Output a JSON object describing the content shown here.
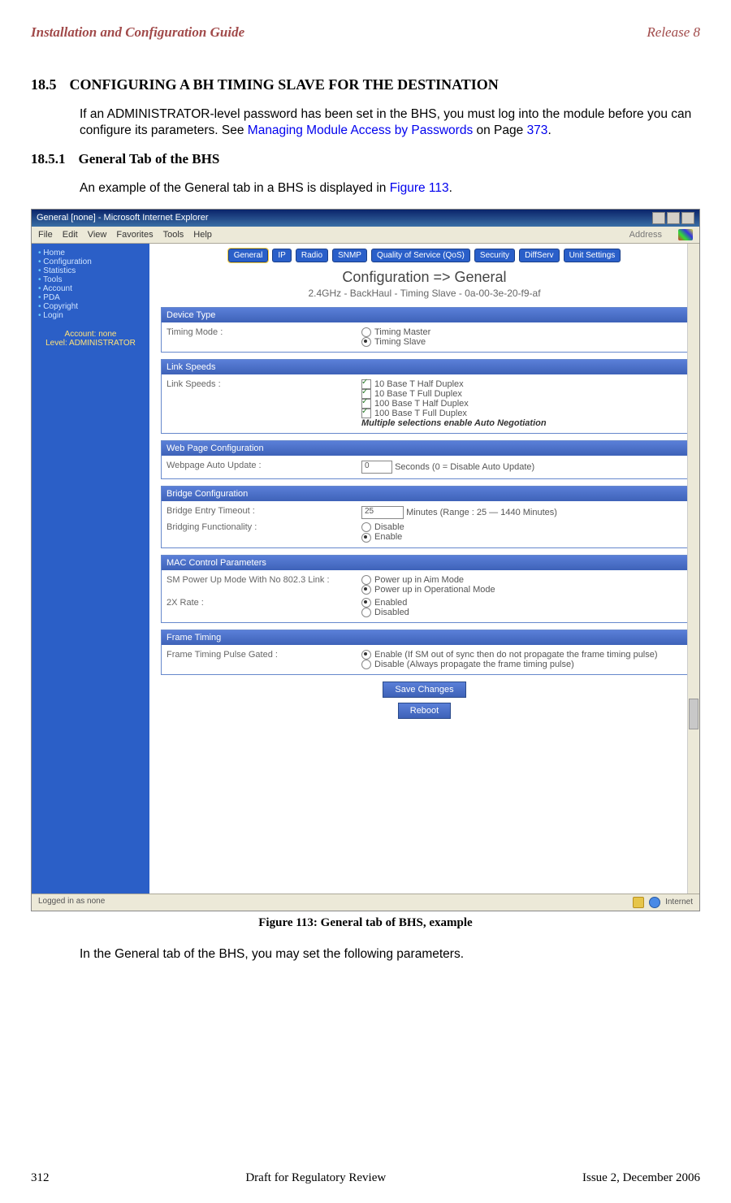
{
  "header": {
    "left": "Installation and Configuration Guide",
    "right": "Release 8"
  },
  "sec": {
    "num": "18.5",
    "title": "CONFIGURING A BH TIMING SLAVE FOR THE DESTINATION"
  },
  "p1_a": "If an ADMINISTRATOR-level password has been set in the BHS, you must log into the module before you can configure its parameters. See ",
  "p1_link": "Managing Module Access by Passwords",
  "p1_b": " on Page ",
  "p1_pg": "373",
  "p1_c": ".",
  "sub": {
    "num": "18.5.1",
    "title": "General Tab of the BHS"
  },
  "p2_a": "An example of the General tab in a BHS is displayed in ",
  "p2_link": "Figure 113",
  "p2_b": ".",
  "caption": "Figure 113: General tab of BHS, example",
  "p3": "In the General tab of the BHS, you may set the following parameters.",
  "footer": {
    "left": "312",
    "center": "Draft for Regulatory Review",
    "right": "Issue 2, December 2006"
  },
  "shot": {
    "title": "General [none] - Microsoft Internet Explorer",
    "menus": [
      "File",
      "Edit",
      "View",
      "Favorites",
      "Tools",
      "Help"
    ],
    "address_lbl": "Address",
    "sidebar_items": [
      "Home",
      "Configuration",
      "Statistics",
      "Tools",
      "Account",
      "PDA",
      "Copyright",
      "Login"
    ],
    "acct1": "Account: none",
    "acct2": "Level: ADMINISTRATOR",
    "tabs": [
      "General",
      "IP",
      "Radio",
      "SNMP",
      "Quality of Service (QoS)",
      "Security",
      "DiffServ",
      "Unit Settings"
    ],
    "page_head": "Configuration => General",
    "page_sub": "2.4GHz - BackHaul - Timing Slave - 0a-00-3e-20-f9-af",
    "panels": {
      "device": {
        "h": "Device Type",
        "lbl": "Timing Mode :",
        "o1": "Timing Master",
        "o2": "Timing Slave"
      },
      "link": {
        "h": "Link Speeds",
        "lbl": "Link Speeds :",
        "c1": "10 Base T Half Duplex",
        "c2": "10 Base T Full Duplex",
        "c3": "100 Base T Half Duplex",
        "c4": "100 Base T Full Duplex",
        "note": "Multiple selections enable Auto Negotiation"
      },
      "web": {
        "h": "Web Page Configuration",
        "lbl": "Webpage Auto Update :",
        "val": "0",
        "unit": "Seconds (0 = Disable Auto Update)"
      },
      "bridge": {
        "h": "Bridge Configuration",
        "lbl1": "Bridge Entry Timeout :",
        "val1": "25",
        "unit1": "Minutes (Range : 25 — 1440 Minutes)",
        "lbl2": "Bridging Functionality :",
        "o1": "Disable",
        "o2": "Enable"
      },
      "mac": {
        "h": "MAC Control Parameters",
        "lbl1": "SM Power Up Mode With No 802.3 Link :",
        "o1a": "Power up in Aim Mode",
        "o1b": "Power up in Operational Mode",
        "lbl2": "2X Rate :",
        "o2a": "Enabled",
        "o2b": "Disabled"
      },
      "frame": {
        "h": "Frame Timing",
        "lbl": "Frame Timing Pulse Gated :",
        "o1": "Enable (If SM out of sync then do not propagate the frame timing pulse)",
        "o2": "Disable (Always propagate the frame timing pulse)"
      }
    },
    "btn_save": "Save Changes",
    "btn_reboot": "Reboot",
    "status_left": "Logged in as none",
    "status_right": "Internet"
  }
}
